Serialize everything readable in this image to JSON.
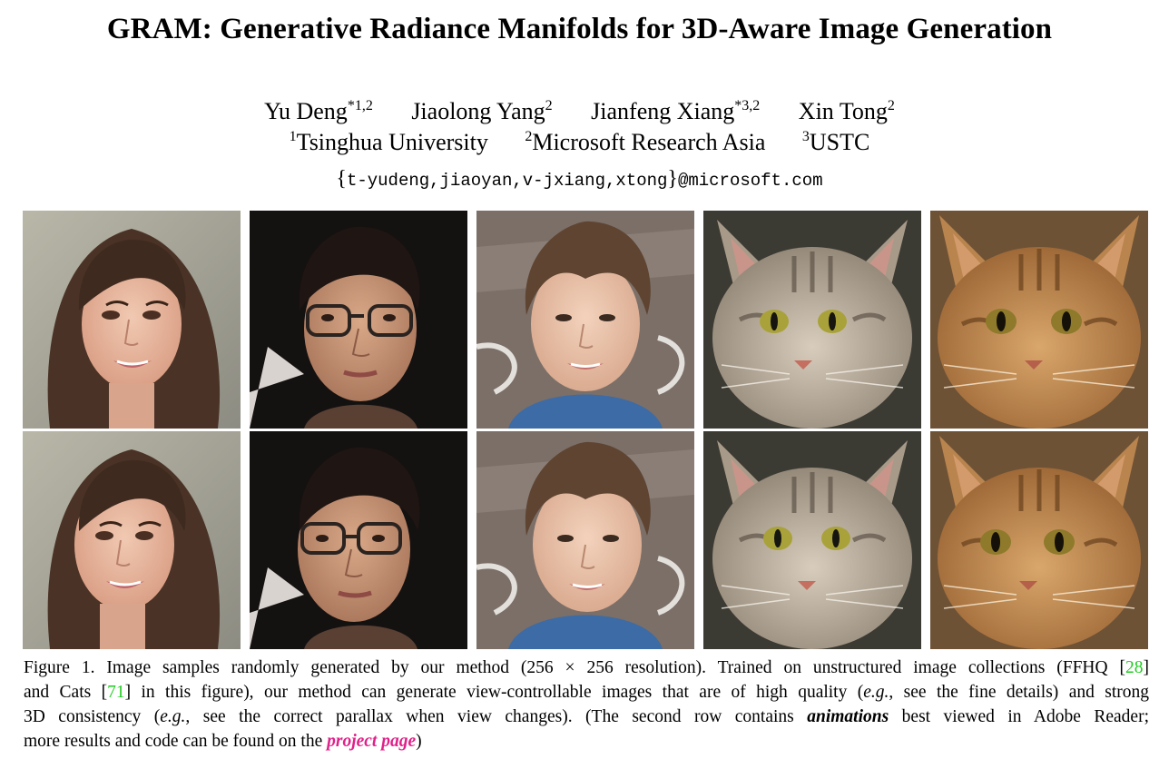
{
  "paper": {
    "title": "GRAM: Generative Radiance Manifolds for 3D-Aware Image Generation",
    "authors": [
      {
        "name": "Yu Deng",
        "sup": "*1,2"
      },
      {
        "name": "Jiaolong Yang",
        "sup": "2"
      },
      {
        "name": "Jianfeng Xiang",
        "sup": "*3,2"
      },
      {
        "name": "Xin Tong",
        "sup": "2"
      }
    ],
    "affiliations": [
      {
        "sup": "1",
        "name": "Tsinghua University"
      },
      {
        "sup": "2",
        "name": "Microsoft Research Asia"
      },
      {
        "sup": "3",
        "name": "USTC"
      }
    ],
    "email": {
      "open": "{",
      "names": "t-yudeng,jiaoyan,v-jxiang,xtong",
      "close": "}",
      "domain": "@microsoft.com"
    }
  },
  "figure": {
    "images": [
      [
        {
          "subject": "woman-face"
        },
        {
          "subject": "man-glasses-face"
        },
        {
          "subject": "boy-face"
        },
        {
          "subject": "gray-tabby-cat"
        },
        {
          "subject": "orange-tabby-cat"
        }
      ],
      [
        {
          "subject": "woman-face"
        },
        {
          "subject": "man-glasses-face"
        },
        {
          "subject": "boy-face"
        },
        {
          "subject": "gray-tabby-cat"
        },
        {
          "subject": "orange-tabby-cat"
        }
      ]
    ],
    "caption": {
      "l1_a": "Figure 1. Image samples randomly generated by our method (256 × 256 resolution). Trained on unstructured image collections (FFHQ [",
      "cite1": "28",
      "l1_b": "]",
      "l2_a": "and Cats [",
      "cite2": "71",
      "l2_b": "] in this figure), our method can generate view-controllable images that are of high quality (",
      "eg1": "e.g.",
      "l2_c": ", see the fine details) and strong",
      "l3_a": "3D consistency (",
      "eg2": "e.g.",
      "l3_b": ", see the correct parallax when view changes). (The second row contains ",
      "animations": "animations",
      "l3_c": " best viewed in Adobe Reader;",
      "l4_a": "more results and code can be found on the ",
      "project_page": "project page",
      "l4_b": ")"
    },
    "colors": {
      "citation": "#1fcc1f",
      "link": "#e0218a"
    }
  }
}
